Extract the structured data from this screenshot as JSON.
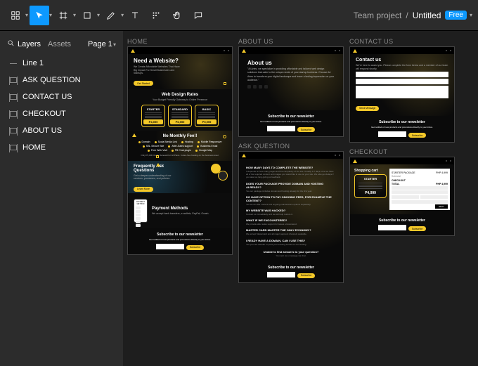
{
  "toolbar": {
    "breadcrumb_team": "Team project",
    "breadcrumb_sep": "/",
    "breadcrumb_title": "Untitled",
    "badge": "Free"
  },
  "left_panel": {
    "tab_layers": "Layers",
    "tab_assets": "Assets",
    "pages_label": "Page 1",
    "layers": [
      {
        "type": "line",
        "label": "Line 1"
      },
      {
        "type": "frame",
        "label": "ASK QUESTION"
      },
      {
        "type": "frame",
        "label": "CONTACT US"
      },
      {
        "type": "frame",
        "label": "CHECKOUT"
      },
      {
        "type": "frame",
        "label": "ABOUT US"
      },
      {
        "type": "frame",
        "label": "HOME"
      }
    ]
  },
  "canvas": {
    "home": {
      "title": "HOME",
      "hero_h": "Need a Website?",
      "hero_sub": "We Create Affordable Websites That Have Big Impact For Small Businesses and Startups.",
      "hero_cta": "Get Started",
      "rates_h": "Web Design Rates",
      "rates_sub": "Your Budget Friendly Gateway to Online Presence",
      "plans": [
        {
          "name": "STARTER",
          "price": "P4,999"
        },
        {
          "name": "STANDARD",
          "price": "P6,999"
        },
        {
          "name": "BASIC",
          "price": "P9,999"
        }
      ],
      "nomonthly_h": "No Monthly Fee!!",
      "features": [
        "Domain",
        "Social Media Link",
        "Hosting",
        "Mobile Responsive",
        "SSL Secure Site",
        "After-Sales support",
        "Business Email",
        "Free Web Visit",
        "FB Chat plugin",
        "Google Map"
      ],
      "nomonthly_note": "Only P3,000 Yearly Renewal for All Plans. Cutter-free hosting on the business level.",
      "faq_h": "Frequently Ask Questions",
      "faq_sub": "Get a deeper understanding of our services, processes, and policies.",
      "faq_cta": "Learn More",
      "pay_h": "Payment Methods",
      "pay_sub": "We accept bank transfers, e-wallets, PayPal, Gcash.",
      "pay_labels": [
        "PAYMENT METHOD",
        "BDO",
        "PayPal"
      ],
      "news_h": "Subscribe to our newsletter",
      "news_sub": "Get notified of new products and promotions directly to your inbox.",
      "news_btn": "Subscribe"
    },
    "about": {
      "title": "ABOUT US",
      "h": "About us",
      "body": "\"At Aries, we specialize in providing affordable and tailored web design solutions that cater to the unique needs of your startup business. Choose Art Aries to transform your digital landscape and leave a lasting impression on your audience.\"",
      "news_h": "Subscribe to our newsletter",
      "news_sub": "Get notified of new products and promotions directly to your inbox.",
      "news_btn": "Subscribe"
    },
    "contact": {
      "title": "CONTACT US",
      "h": "Contact us",
      "sub": "We're here to assist you. Please complete the form below and a member of our team will respond shortly.",
      "btn": "Send Message",
      "news_h": "Subscribe to our newsletter",
      "news_sub": "Get notified of new products and promotions directly to your inbox.",
      "news_btn": "Subscribe"
    },
    "askq": {
      "title": "ASK QUESTION",
      "q1": "HOW MANY DAYS TO COMPLETE THE WEBSITE?",
      "a1": "It depends on how many pages and the complexity of the site. Usually 3-7 days once we have all of the required content and images you would like to use on your site. We also get delays if you take too long giving us feedback.",
      "q2": "DOES YOUR PACKAGE PROVIDE DOMAIN AND HOSTING ALREADY?",
      "q3": "DO HAVE OPTION TO PAY ONGOING FEES, FOR EXAMPLE THE CONTENT?",
      "q4": "MY WEBSITE WAS HACKED?",
      "q5": "WHAT IF WE ENCOUNTERED?",
      "q6": "MASTER CARD MASTER THE ONLY ECONOMY?",
      "q7": "I READY HAVE A DOMAIN, CAN I USE THIS?",
      "foot1": "Unable to find answers to your question?",
      "foot2": "You sent us a message via chat.",
      "news_h": "Subscribe to our newsletter",
      "news_btn": "Subscribe"
    },
    "checkout": {
      "title": "CHECKOUT",
      "cart_h": "Shopping cart",
      "plan": "STARTER",
      "price": "P4,999",
      "right_h1": "STARTER PACKAGE",
      "right_sub": "Subtotal",
      "right_p1": "PHP 4,999",
      "right_h2": "CHECKOUT",
      "right_total": "TOTAL",
      "right_p2": "PHP 4,999",
      "next": "NEXT",
      "news_h": "Subscribe to our newsletter",
      "news_btn": "Subscribe"
    }
  }
}
